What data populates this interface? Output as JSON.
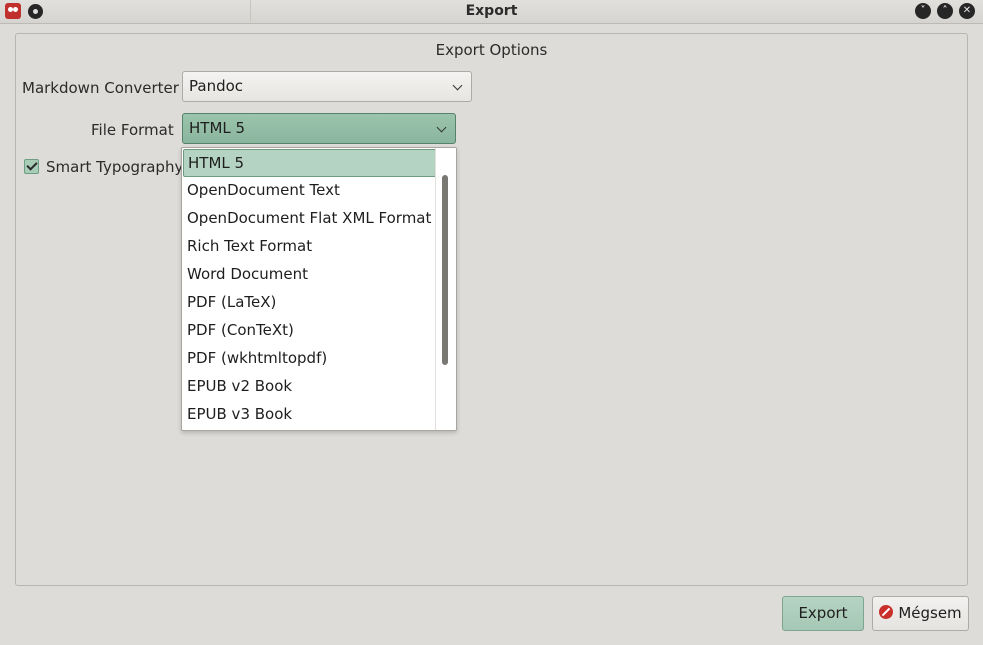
{
  "window": {
    "title": "Export"
  },
  "options": {
    "group_title": "Export Options",
    "converter_label": "Markdown Converter",
    "converter_value": "Pandoc",
    "format_label": "File Format",
    "format_value": "HTML 5",
    "smart_typography_label": "Smart Typography",
    "smart_typography_checked": true
  },
  "format_dropdown": {
    "items": [
      "HTML 5",
      "OpenDocument Text",
      "OpenDocument Flat XML Format",
      "Rich Text Format",
      "Word Document",
      "PDF (LaTeX)",
      "PDF (ConTeXt)",
      "PDF (wkhtmltopdf)",
      "EPUB v2 Book",
      "EPUB v3 Book"
    ],
    "selected_index": 0
  },
  "buttons": {
    "export_label": "Export",
    "cancel_label": "Mégsem"
  },
  "colors": {
    "accent": "#8ab59d",
    "selection": "#b5d3c2",
    "cancel_icon": "#c9302c"
  }
}
